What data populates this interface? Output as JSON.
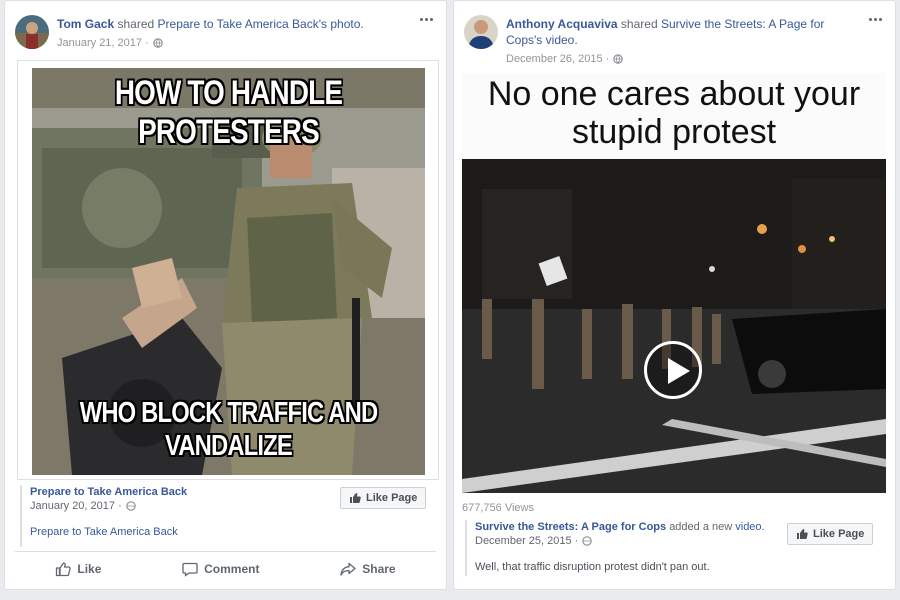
{
  "left_post": {
    "author": "Tom Gack",
    "shared_text": "shared",
    "source_link": "Prepare to Take America Back's photo.",
    "timestamp": "January 21, 2017 ·",
    "meme_top_text": "HOW TO HANDLE PROTESTERS",
    "meme_bottom_text": "WHO BLOCK TRAFFIC AND VANDALIZE",
    "attribution_page": "Prepare to Take America Back",
    "attribution_date": "January 20, 2017 ·",
    "attribution_caption": "Prepare to Take America Back",
    "like_page_label": "Like Page",
    "actions": {
      "like": "Like",
      "comment": "Comment",
      "share": "Share"
    }
  },
  "right_post": {
    "author": "Anthony Acquaviva",
    "shared_text": "shared",
    "source_link": "Survive the Streets: A Page for Cops's",
    "source_link_2": "video.",
    "timestamp": "December 26, 2015 ·",
    "video_line_1": "No one cares about your",
    "video_line_2": "stupid protest",
    "views": "677,756 Views",
    "attribution_page": "Survive the Streets: A Page for Cops",
    "attribution_added": "added a new",
    "attribution_link": "video.",
    "attribution_date": "December 25, 2015 ·",
    "attribution_caption": "Well, that traffic disruption protest didn't pan out.",
    "like_page_label": "Like Page"
  },
  "colors": {
    "link": "#385898",
    "meta": "#90949c",
    "border": "#dddfe2"
  }
}
